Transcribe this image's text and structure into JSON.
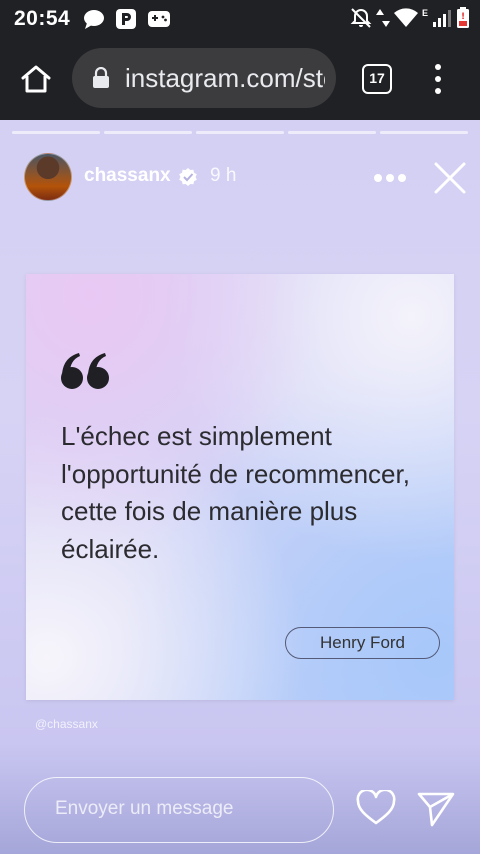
{
  "status_bar": {
    "time": "20:54",
    "icons_left": [
      "chat-bubble-icon",
      "parking-app-icon",
      "gamepad-icon"
    ],
    "icons_right": [
      "muted-bell-icon",
      "data-arrows-icon",
      "wifi-icon",
      "network-e-label",
      "signal-icon",
      "battery-low-icon"
    ],
    "network_type": "E"
  },
  "browser": {
    "url": "instagram.com/stories/chassanx",
    "tab_count": "17",
    "icons": [
      "home-icon",
      "lock-icon",
      "overflow-menu-icon"
    ]
  },
  "story": {
    "progress_segments": 5,
    "username": "chassanx",
    "verified": true,
    "time_ago": "9 h",
    "quote_text": "L'échec est simplement l'opportunité de recommencer, cette fois de manière plus éclairée.",
    "author": "Henry Ford",
    "watermark": "@chassanx"
  },
  "reply_bar": {
    "placeholder": "Envoyer un message"
  },
  "colors": {
    "chrome_bar": "#202124",
    "url_pill": "#3c3c3f",
    "story_background": "#d7d3f4",
    "quote_text": "#2b2b30"
  }
}
